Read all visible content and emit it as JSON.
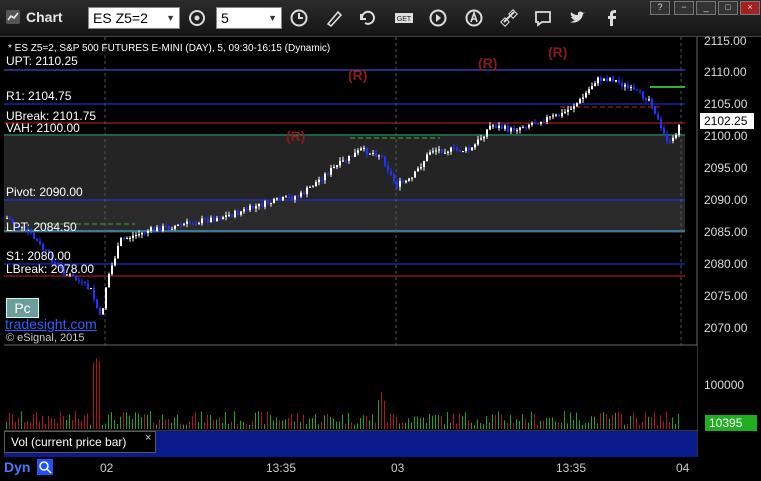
{
  "window": {
    "title": "Chart",
    "symbol": "ES Z5=2",
    "interval": "5"
  },
  "toolbar": {
    "icons": [
      "cursor-icon",
      "draw-icon",
      "refresh-icon",
      "get-icon",
      "play-icon",
      "alert-icon",
      "link-icon",
      "chat-icon",
      "twitter-icon",
      "facebook-icon"
    ]
  },
  "chart": {
    "description": "* ES Z5=2, S&P 500 FUTURES E-MINI (DAY), 5, 09:30-16:15 (Dynamic)",
    "watermark_link": "tradesight.com",
    "copyright": "© eSignal, 2015",
    "pc_label": "Pc",
    "last_price": "2102.25",
    "levels": {
      "upt": "UPT: 2110.25",
      "r1": "R1: 2104.75",
      "ubreak": "UBreak: 2101.75",
      "vah": "VAH: 2100.00",
      "pivot": "Pivot: 2090.00",
      "lpt": "LPT: 2084.50",
      "s1": "S1: 2080.00",
      "lbreak": "LBreak: 2078.00"
    },
    "r_markers": [
      "(R)",
      "(R)",
      "(R)",
      "(R)"
    ],
    "price_axis": [
      "2115.00",
      "2110.00",
      "2105.00",
      "2100.00",
      "2095.00",
      "2090.00",
      "2085.00",
      "2080.00",
      "2075.00",
      "2070.00"
    ],
    "volume_axis": [
      "100000"
    ],
    "volume_last": "10395",
    "volume_label": "Vol (current price bar)",
    "volume_close": "×",
    "time_axis": [
      "02",
      "13:35",
      "03",
      "13:35",
      "04"
    ],
    "status": {
      "dyn": "Dyn"
    }
  },
  "colors": {
    "accent_blue": "#1f3cff",
    "up_bar": "#ffffff",
    "down_bar": "#2233ff",
    "volume_up": "#1fa51f",
    "volume_down": "#b01818",
    "pivot_line": "#2233ff",
    "r_line": "#cc2222",
    "green_line": "#2fb02f"
  }
}
